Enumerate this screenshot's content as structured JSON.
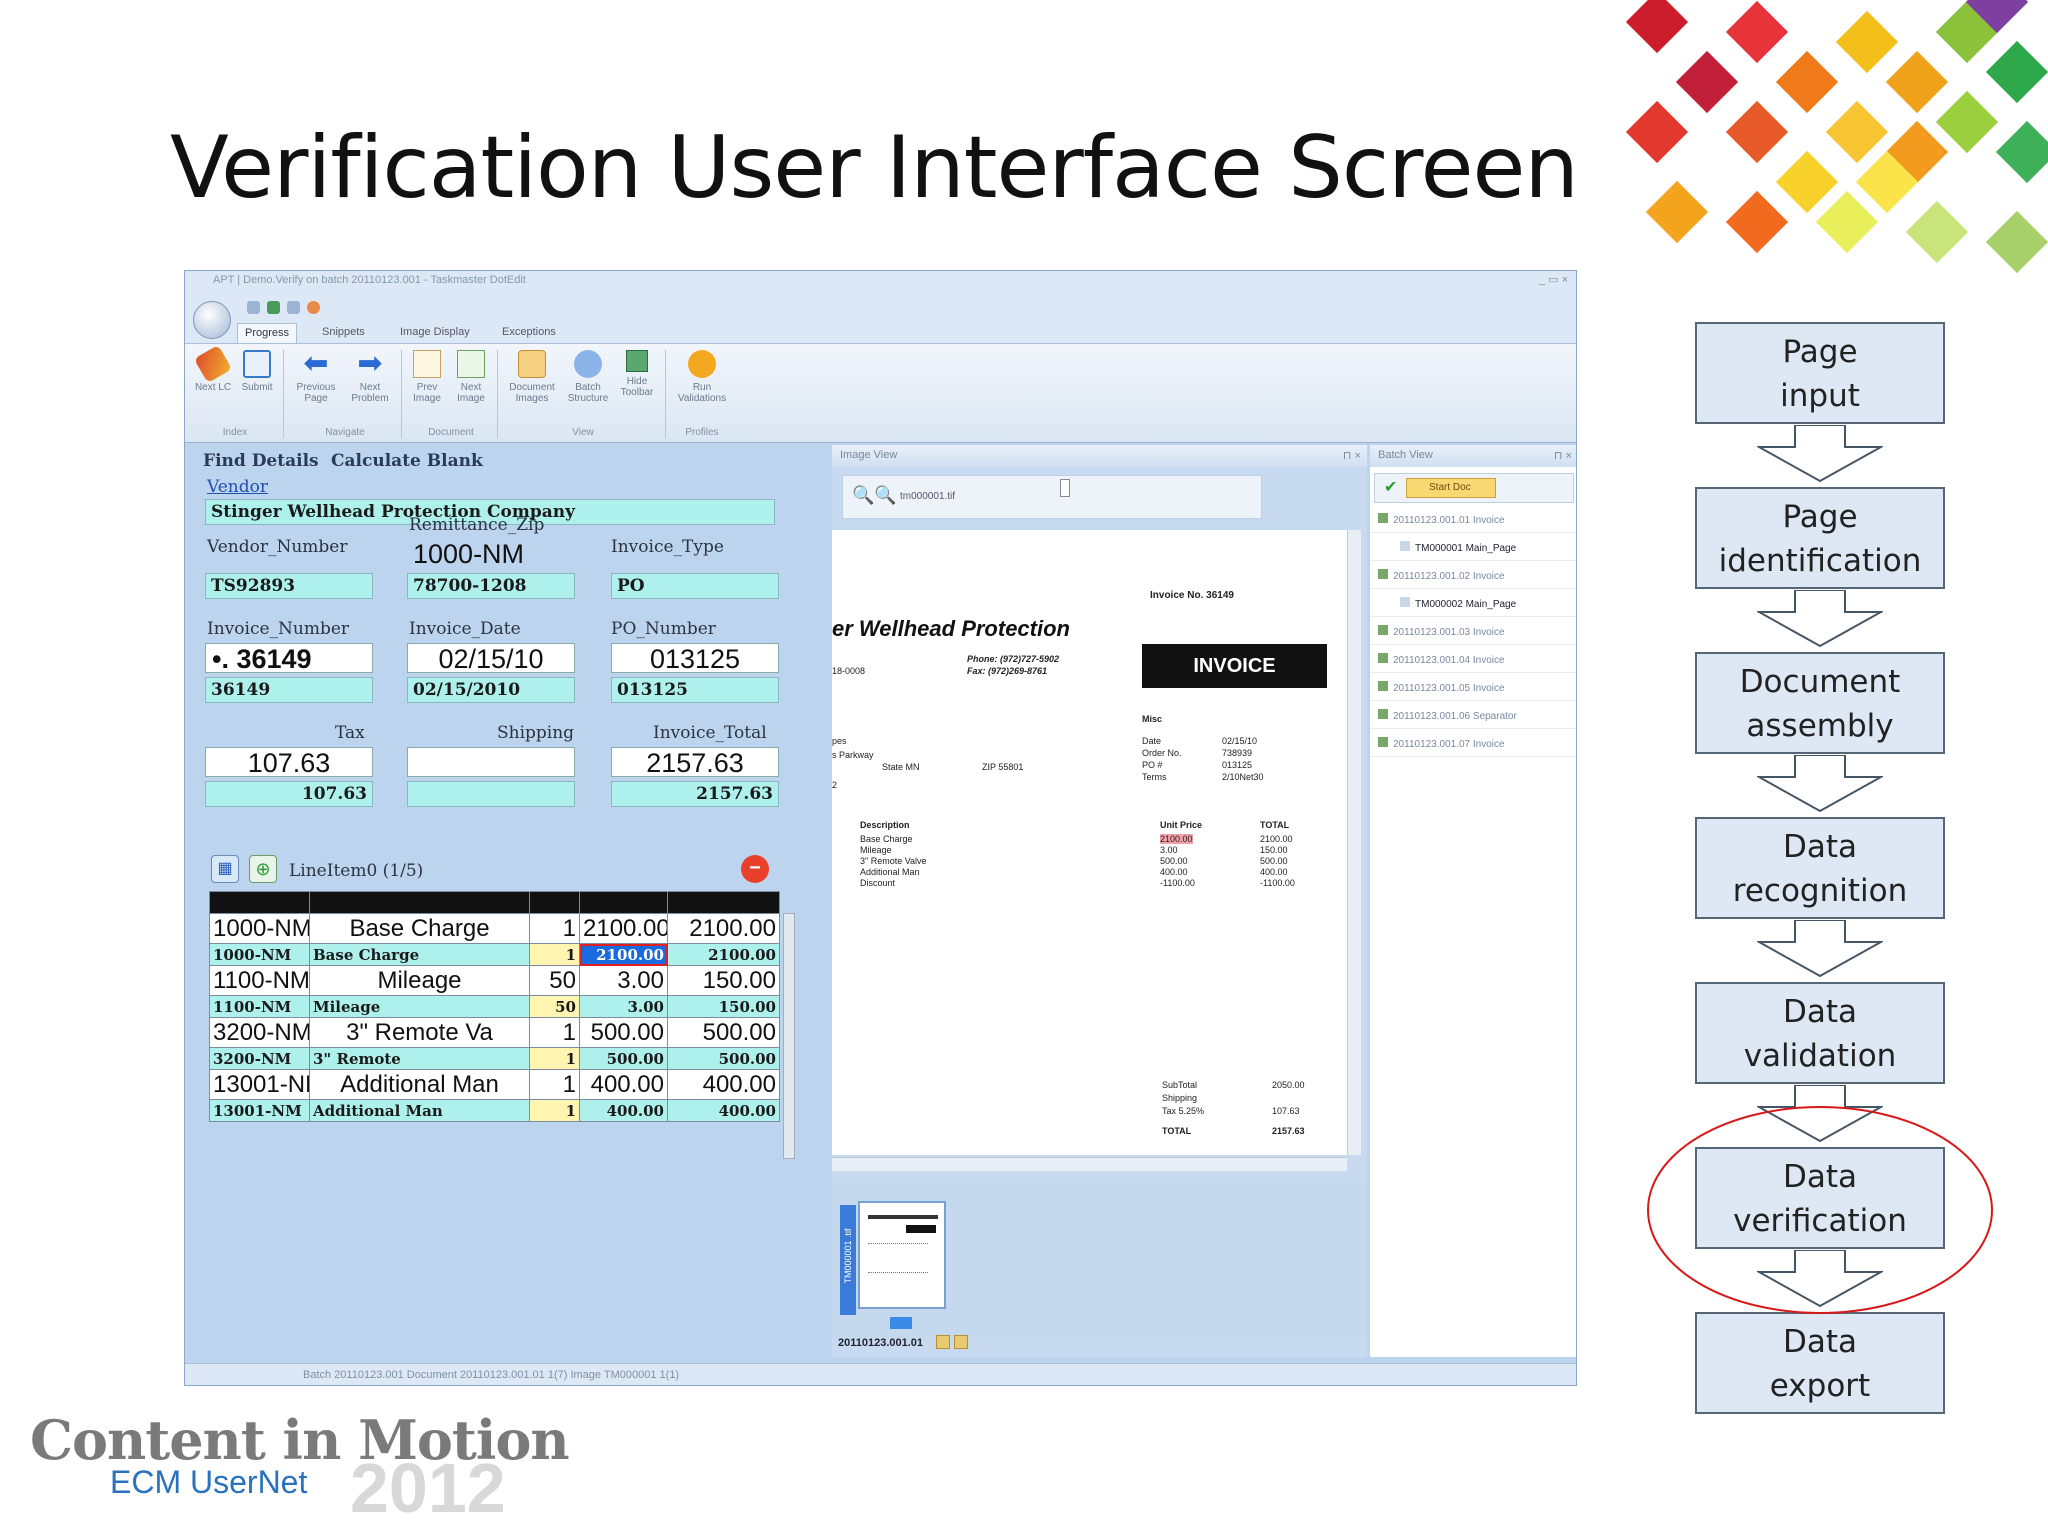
{
  "slide": {
    "title": "Verification User Interface Screen",
    "logo_line1": "Content in Motion",
    "logo_line2": "ECM UserNet",
    "logo_year": "2012"
  },
  "window": {
    "title": "APT | Demo.Verify on batch 20110123.001 - Taskmaster DotEdit",
    "tabs": [
      "Progress",
      "Snippets",
      "Image Display",
      "Exceptions"
    ],
    "ribbon": {
      "buttons": [
        {
          "label": "Next LC",
          "icon": "next-lc-icon"
        },
        {
          "label": "Submit",
          "icon": "submit-icon"
        },
        {
          "label": "Previous Page",
          "icon": "arrow-left-icon"
        },
        {
          "label": "Next Problem",
          "icon": "arrow-right-icon"
        },
        {
          "label": "Prev Image",
          "icon": "prev-image-icon"
        },
        {
          "label": "Next Image",
          "icon": "next-image-icon"
        },
        {
          "label": "Document Images",
          "icon": "document-images-icon"
        },
        {
          "label": "Batch Structure",
          "icon": "batch-structure-icon"
        },
        {
          "label": "Hide Toolbar",
          "icon": "hide-toolbar-icon"
        },
        {
          "label": "Run Validations",
          "icon": "run-validations-icon"
        }
      ],
      "groups": [
        "Index",
        "Navigate",
        "Document",
        "View",
        "Profiles"
      ]
    }
  },
  "form": {
    "buttons": [
      "Find Details",
      "Calculate Blank"
    ],
    "vendor_label": "Vendor",
    "vendor_value": "Stinger Wellhead Protection Company",
    "fields": [
      {
        "label": "Vendor_Number",
        "img": "",
        "value": "TS92893"
      },
      {
        "label": "Remittance_Zip",
        "img": "1000-NM",
        "value": "78700-1208"
      },
      {
        "label": "Invoice_Type",
        "img": "",
        "value": "PO"
      },
      {
        "label": "Invoice_Number",
        "img": "•.  36149",
        "value": "36149"
      },
      {
        "label": "Invoice_Date",
        "img": "02/15/10",
        "value": "02/15/2010"
      },
      {
        "label": "PO_Number",
        "img": "013125",
        "value": "013125"
      },
      {
        "label": "Tax",
        "img": "107.63",
        "value": "107.63"
      },
      {
        "label": "Shipping",
        "img": "",
        "value": ""
      },
      {
        "label": "Invoice_Total",
        "img": "2157.63",
        "value": "2157.63"
      }
    ],
    "lineitem_label": "LineItem0 (1/5)",
    "rows": [
      {
        "img": [
          "1000-NM",
          "Base Charge",
          "1",
          "2100.00",
          "2100.00"
        ],
        "val": [
          "1000-NM",
          "Base Charge",
          "1",
          "2100.00",
          "2100.00"
        ]
      },
      {
        "img": [
          "1100-NM",
          "Mileage",
          "50",
          "3.00",
          "150.00"
        ],
        "val": [
          "1100-NM",
          "Mileage",
          "50",
          "3.00",
          "150.00"
        ]
      },
      {
        "img": [
          "3200-NM",
          "3\" Remote Va",
          "1",
          "500.00",
          "500.00"
        ],
        "val": [
          "3200-NM",
          "3\" Remote",
          "1",
          "500.00",
          "500.00"
        ]
      },
      {
        "img": [
          "13001-NM",
          "Additional Man",
          "1",
          "400.00",
          "400.00"
        ],
        "val": [
          "13001-NM",
          "Additional Man",
          "1",
          "400.00",
          "400.00"
        ]
      }
    ]
  },
  "image_view": {
    "title": "Image View",
    "file": "tm000001.tif",
    "vendor": "er Wellhead Protection",
    "invoice_no_label": "Invoice No.",
    "invoice_no": "36149",
    "invoice_word": "INVOICE",
    "phone": "Phone: (972)727-5902",
    "fax": "Fax: (972)269-8761",
    "ref": "18-0008",
    "misc": "Misc",
    "meta": [
      [
        "Date",
        "02/15/10"
      ],
      [
        "Order No.",
        "738939"
      ],
      [
        "PO #",
        "013125"
      ],
      [
        "Terms",
        "2/10Net30"
      ]
    ],
    "addr": [
      "pes",
      "s Parkway",
      "State  MN",
      "ZIP  55801",
      "2"
    ],
    "cols": [
      "Description",
      "Unit Price",
      "TOTAL"
    ],
    "lines": [
      [
        "Base Charge",
        "2100.00",
        "2100.00"
      ],
      [
        "Mileage",
        "3.00",
        "150.00"
      ],
      [
        "3\" Remote Valve",
        "500.00",
        "500.00"
      ],
      [
        "Additional Man",
        "400.00",
        "400.00"
      ],
      [
        "Discount",
        "-1100.00",
        "-1100.00"
      ]
    ],
    "totals": [
      [
        "SubTotal",
        "2050.00"
      ],
      [
        "Shipping",
        ""
      ],
      [
        "Tax 5.25%",
        "107.63"
      ],
      [
        "TOTAL",
        "2157.63"
      ]
    ],
    "thumb_label": "20110123.001.01",
    "thumb_side": "TM000001 .tif"
  },
  "batch_view": {
    "title": "Batch View",
    "start_label": "Start Doc",
    "items": [
      "20110123.001.01 Invoice",
      "TM000001 Main_Page",
      "20110123.001.02 Invoice",
      "TM000002 Main_Page",
      "20110123.001.03 Invoice",
      "20110123.001.04 Invoice",
      "20110123.001.05 Invoice",
      "20110123.001.06 Separator",
      "20110123.001.07 Invoice"
    ]
  },
  "status": "Batch 20110123.001   Document 20110123.001.01 1(7)   Image TM000001 1(1)",
  "flow": {
    "steps": [
      [
        "Page",
        "input"
      ],
      [
        "Page",
        "identification"
      ],
      [
        "Document",
        "assembly"
      ],
      [
        "Data",
        "recognition"
      ],
      [
        "Data",
        "validation"
      ],
      [
        "Data",
        "verification"
      ],
      [
        "Data",
        "export"
      ]
    ],
    "highlight": "Data verification"
  },
  "colors": {
    "cyan_field": "#aef0ec",
    "panel": "#bcd4ee",
    "highlight_ring": "#d81818"
  }
}
